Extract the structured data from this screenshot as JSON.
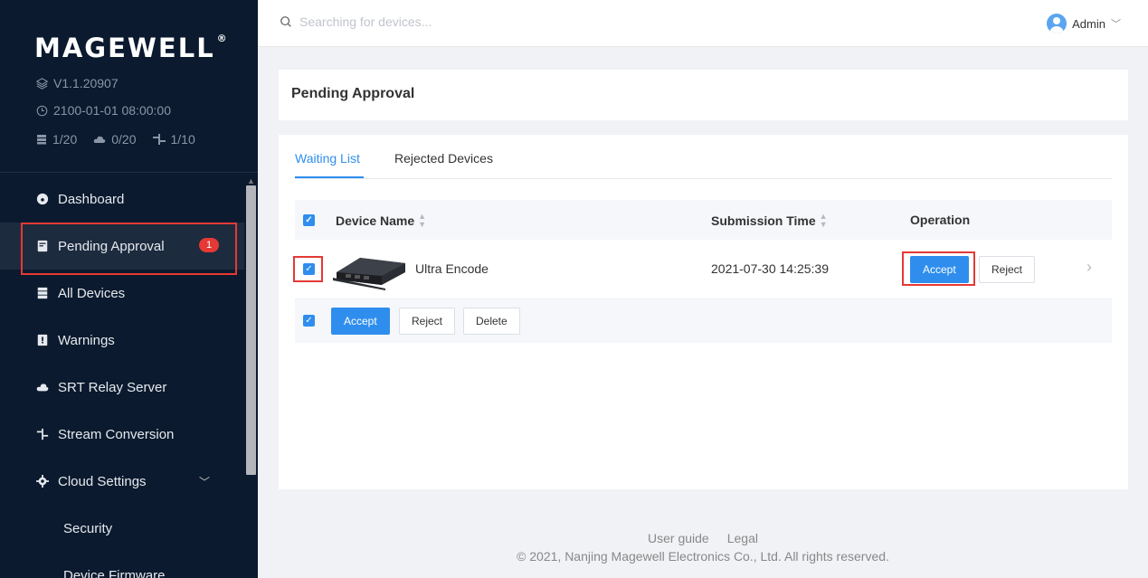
{
  "sidebar": {
    "logo": "MAGEWELL",
    "logo_reg": "®",
    "version": "V1.1.20907",
    "datetime": "2100-01-01 08:00:00",
    "counts": {
      "devices": "1/20",
      "cloud": "0/20",
      "stream": "1/10"
    },
    "items": [
      {
        "label": "Dashboard",
        "icon": "dashboard-icon"
      },
      {
        "label": "Pending Approval",
        "icon": "pending-icon",
        "badge": "1"
      },
      {
        "label": "All Devices",
        "icon": "devices-icon"
      },
      {
        "label": "Warnings",
        "icon": "warnings-icon"
      },
      {
        "label": "SRT Relay Server",
        "icon": "cloud-icon"
      },
      {
        "label": "Stream Conversion",
        "icon": "stream-icon"
      },
      {
        "label": "Cloud Settings",
        "icon": "gear-icon"
      }
    ],
    "sub_items": [
      {
        "label": "Security"
      },
      {
        "label": "Device Firmware"
      }
    ]
  },
  "topbar": {
    "search_placeholder": "Searching for devices...",
    "user": "Admin"
  },
  "page": {
    "title": "Pending Approval",
    "tabs": [
      {
        "label": "Waiting List"
      },
      {
        "label": "Rejected Devices"
      }
    ],
    "table": {
      "headers": {
        "device_name": "Device Name",
        "submission_time": "Submission Time",
        "operation": "Operation"
      },
      "rows": [
        {
          "device_name": "Ultra Encode",
          "submission_time": "2021-07-30 14:25:39",
          "accept": "Accept",
          "reject": "Reject"
        }
      ],
      "bulk": {
        "accept": "Accept",
        "reject": "Reject",
        "delete": "Delete"
      }
    }
  },
  "footer": {
    "user_guide": "User guide",
    "legal": "Legal",
    "copyright": "© 2021, Nanjing Magewell Electronics Co., Ltd. All rights reserved."
  },
  "colors": {
    "accent": "#2f8eed",
    "sidebar": "#0b1a2e",
    "highlight": "#e53935"
  }
}
